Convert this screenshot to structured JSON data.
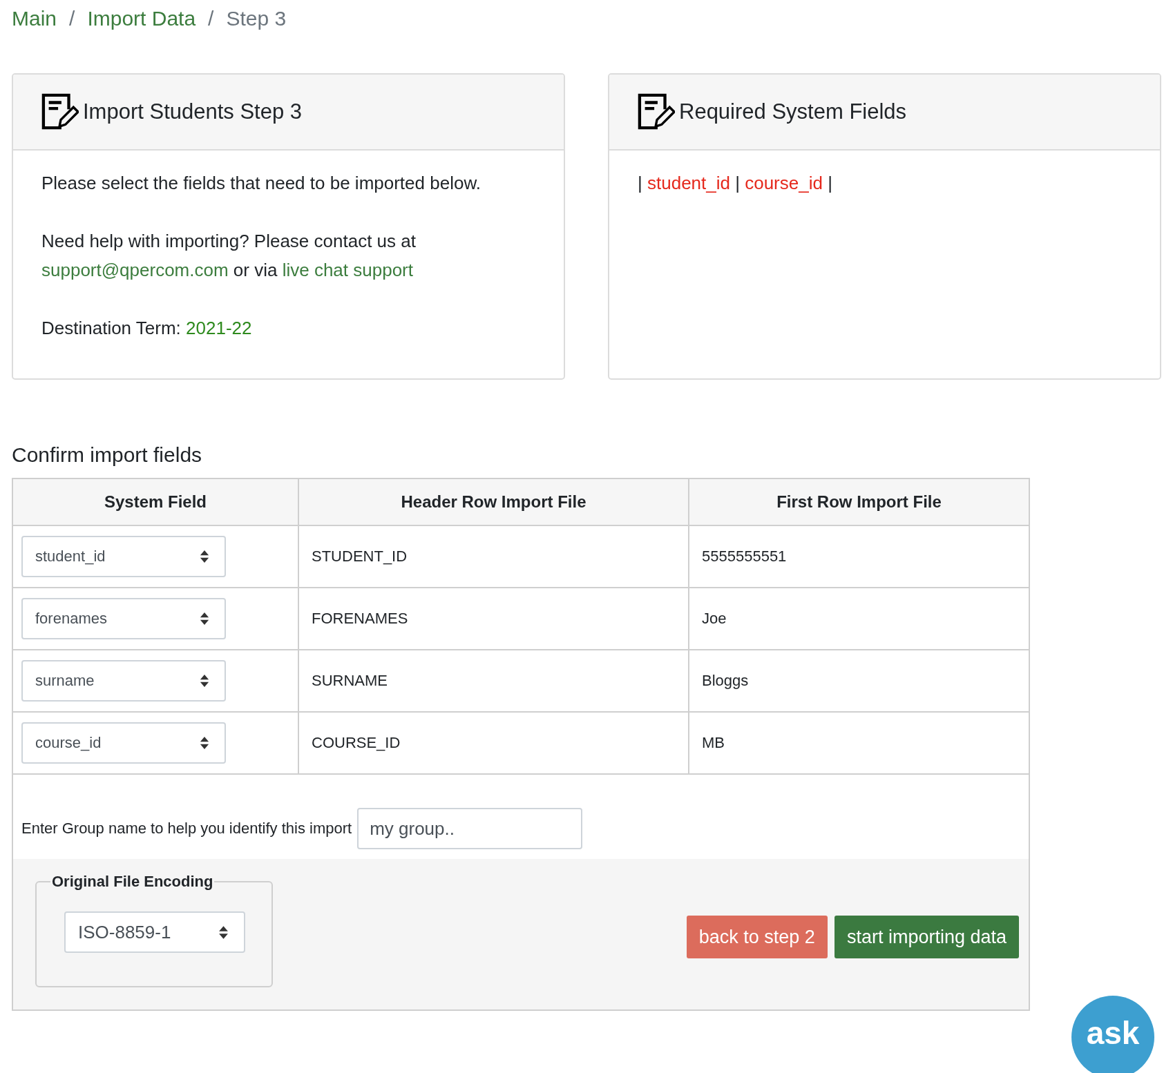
{
  "breadcrumb": [
    {
      "label": "Main",
      "current": false
    },
    {
      "label": "Import Data",
      "current": false
    },
    {
      "label": "Step 3",
      "current": true
    }
  ],
  "breadcrumb_separator": "/",
  "info_card": {
    "title": "Import Students Step 3",
    "instruction": "Please select the fields that need to be imported below.",
    "help_text": "Need help with importing? Please contact us at",
    "email_link": "support@qpercom.com",
    "or_text": "or via",
    "chat_link": "live chat support",
    "term_label": "Destination Term:",
    "term_value": "2021-22"
  },
  "required_card": {
    "title": "Required System Fields",
    "separator": "|",
    "fields": [
      "student_id",
      "course_id"
    ]
  },
  "section_title": "Confirm import fields",
  "table": {
    "columns": [
      "System Field",
      "Header Row Import File",
      "First Row Import File"
    ],
    "rows": [
      {
        "system_field": "student_id",
        "header": "STUDENT_ID",
        "first_row": "5555555551"
      },
      {
        "system_field": "forenames",
        "header": "FORENAMES",
        "first_row": "Joe"
      },
      {
        "system_field": "surname",
        "header": "SURNAME",
        "first_row": "Bloggs"
      },
      {
        "system_field": "course_id",
        "header": "COURSE_ID",
        "first_row": "MB"
      }
    ]
  },
  "group_name": {
    "label": "Enter Group name to help you identify this import",
    "placeholder": "my group.."
  },
  "encoding": {
    "legend": "Original File Encoding",
    "value": "ISO-8859-1"
  },
  "buttons": [
    {
      "label": "back to step 2",
      "kind": "danger"
    },
    {
      "label": "start importing data",
      "kind": "success"
    }
  ],
  "chat_button": {
    "label": "ask"
  }
}
